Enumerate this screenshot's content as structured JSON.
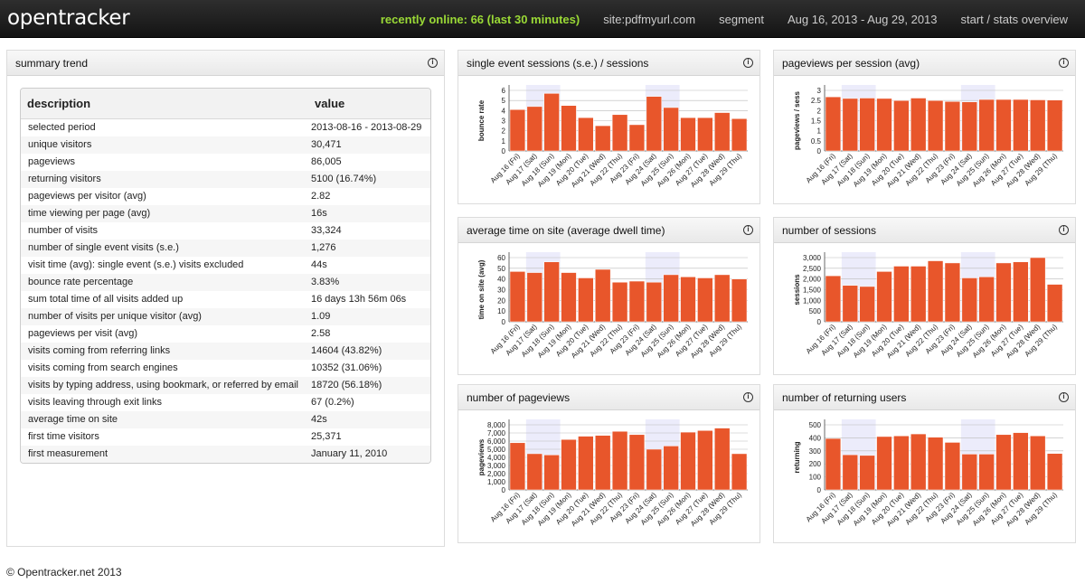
{
  "header": {
    "logo": "opentracker",
    "online": "recently online: 66 (last 30 minutes)",
    "site": "site:pdfmyurl.com",
    "segment": "segment",
    "period": "Aug 16, 2013 - Aug 29, 2013",
    "crumb": "start / stats overview"
  },
  "summary": {
    "title": "summary trend",
    "col_desc": "description",
    "col_value": "value",
    "rows": [
      {
        "d": "selected period",
        "v": "2013-08-16 - 2013-08-29"
      },
      {
        "d": "unique visitors",
        "v": "30,471"
      },
      {
        "d": "pageviews",
        "v": "86,005"
      },
      {
        "d": "returning visitors",
        "v": "5100 (16.74%)"
      },
      {
        "d": "pageviews per visitor (avg)",
        "v": "2.82"
      },
      {
        "d": "time viewing per page (avg)",
        "v": "16s"
      },
      {
        "d": "number of visits",
        "v": "33,324"
      },
      {
        "d": "number of single event visits (s.e.)",
        "v": "1,276"
      },
      {
        "d": "visit time (avg): single event (s.e.) visits excluded",
        "v": "44s"
      },
      {
        "d": "bounce rate percentage",
        "v": "3.83%"
      },
      {
        "d": "sum total time of all visits added up",
        "v": "16 days 13h 56m 06s"
      },
      {
        "d": "number of visits per unique visitor (avg)",
        "v": "1.09"
      },
      {
        "d": "pageviews per visit (avg)",
        "v": "2.58"
      },
      {
        "d": "visits coming from referring links",
        "v": "14604 (43.82%)"
      },
      {
        "d": "visits coming from search engines",
        "v": "10352 (31.06%)"
      },
      {
        "d": "visits by typing address, using bookmark, or referred by email",
        "v": "18720 (56.18%)"
      },
      {
        "d": "visits leaving through exit links",
        "v": "67 (0.2%)"
      },
      {
        "d": "average time on site",
        "v": "42s"
      },
      {
        "d": "first time visitors",
        "v": "25,371"
      },
      {
        "d": "first measurement",
        "v": "January 11, 2010"
      }
    ]
  },
  "colors": {
    "bar": "#e8562b",
    "weekend": "#ececfb",
    "grid": "#bbbbbb"
  },
  "chart_data": [
    {
      "type": "bar",
      "title": "single event sessions (s.e.) / sessions",
      "ylabel": "bounce rate",
      "ylim": [
        0,
        6
      ],
      "yticks": [
        "0",
        "1",
        "2",
        "3",
        "4",
        "5",
        "6"
      ],
      "categories": [
        "Aug 16 (Fri)",
        "Aug 17 (Sat)",
        "Aug 18 (Sun)",
        "Aug 19 (Mon)",
        "Aug 20 (Tue)",
        "Aug 21 (Wed)",
        "Aug 22 (Thu)",
        "Aug 23 (Fri)",
        "Aug 24 (Sat)",
        "Aug 25 (Sun)",
        "Aug 26 (Mon)",
        "Aug 27 (Tue)",
        "Aug 28 (Wed)",
        "Aug 29 (Thu)"
      ],
      "values": [
        4.1,
        4.4,
        5.7,
        4.5,
        3.3,
        2.5,
        3.6,
        2.6,
        5.4,
        4.3,
        3.3,
        3.3,
        3.8,
        3.2
      ]
    },
    {
      "type": "bar",
      "title": "pageviews per session (avg)",
      "ylabel": "pageviews / sess",
      "ylim": [
        0,
        3
      ],
      "yticks": [
        "0",
        "0.5",
        "1",
        "1.5",
        "2",
        "2.5",
        "3"
      ],
      "categories": [
        "Aug 16 (Fri)",
        "Aug 17 (Sat)",
        "Aug 18 (Sun)",
        "Aug 19 (Mon)",
        "Aug 20 (Tue)",
        "Aug 21 (Wed)",
        "Aug 22 (Thu)",
        "Aug 23 (Fri)",
        "Aug 24 (Sat)",
        "Aug 25 (Sun)",
        "Aug 26 (Mon)",
        "Aug 27 (Tue)",
        "Aug 28 (Wed)",
        "Aug 29 (Thu)"
      ],
      "values": [
        2.68,
        2.6,
        2.62,
        2.6,
        2.5,
        2.62,
        2.5,
        2.45,
        2.43,
        2.55,
        2.55,
        2.55,
        2.53,
        2.52
      ]
    },
    {
      "type": "bar",
      "title": "average time on site (average dwell time)",
      "ylabel": "time on site (avg)",
      "ylim": [
        0,
        60
      ],
      "yticks": [
        "0",
        "10",
        "20",
        "30",
        "40",
        "50",
        "60"
      ],
      "categories": [
        "Aug 16 (Fri)",
        "Aug 17 (Sat)",
        "Aug 18 (Sun)",
        "Aug 19 (Mon)",
        "Aug 20 (Tue)",
        "Aug 21 (Wed)",
        "Aug 22 (Thu)",
        "Aug 23 (Fri)",
        "Aug 24 (Sat)",
        "Aug 25 (Sun)",
        "Aug 26 (Mon)",
        "Aug 27 (Tue)",
        "Aug 28 (Wed)",
        "Aug 29 (Thu)"
      ],
      "values": [
        47,
        46,
        56,
        46,
        41,
        49,
        37,
        38,
        37,
        44,
        42,
        41,
        44,
        40
      ]
    },
    {
      "type": "bar",
      "title": "number of sessions",
      "ylabel": "sessions",
      "ylim": [
        0,
        3000
      ],
      "yticks": [
        "0",
        "500",
        "1,000",
        "1,500",
        "2,000",
        "2,500",
        "3,000"
      ],
      "categories": [
        "Aug 16 (Fri)",
        "Aug 17 (Sat)",
        "Aug 18 (Sun)",
        "Aug 19 (Mon)",
        "Aug 20 (Tue)",
        "Aug 21 (Wed)",
        "Aug 22 (Thu)",
        "Aug 23 (Fri)",
        "Aug 24 (Sat)",
        "Aug 25 (Sun)",
        "Aug 26 (Mon)",
        "Aug 27 (Tue)",
        "Aug 28 (Wed)",
        "Aug 29 (Thu)"
      ],
      "values": [
        2150,
        1700,
        1650,
        2350,
        2600,
        2600,
        2850,
        2750,
        2050,
        2100,
        2750,
        2800,
        3000,
        1750
      ]
    },
    {
      "type": "bar",
      "title": "number of pageviews",
      "ylabel": "pageviews",
      "ylim": [
        0,
        8000
      ],
      "yticks": [
        "0",
        "1,000",
        "2,000",
        "3,000",
        "4,000",
        "5,000",
        "6,000",
        "7,000",
        "8,000"
      ],
      "categories": [
        "Aug 16 (Fri)",
        "Aug 17 (Sat)",
        "Aug 18 (Sun)",
        "Aug 19 (Mon)",
        "Aug 20 (Tue)",
        "Aug 21 (Wed)",
        "Aug 22 (Thu)",
        "Aug 23 (Fri)",
        "Aug 24 (Sat)",
        "Aug 25 (Sun)",
        "Aug 26 (Mon)",
        "Aug 27 (Tue)",
        "Aug 28 (Wed)",
        "Aug 29 (Thu)"
      ],
      "values": [
        5800,
        4450,
        4300,
        6200,
        6600,
        6700,
        7200,
        6800,
        5000,
        5400,
        7100,
        7300,
        7600,
        4450
      ]
    },
    {
      "type": "bar",
      "title": "number of returning users",
      "ylabel": "returning",
      "ylim": [
        0,
        500
      ],
      "yticks": [
        "0",
        "100",
        "200",
        "300",
        "400",
        "500"
      ],
      "categories": [
        "Aug 16 (Fri)",
        "Aug 17 (Sat)",
        "Aug 18 (Sun)",
        "Aug 19 (Mon)",
        "Aug 20 (Tue)",
        "Aug 21 (Wed)",
        "Aug 22 (Thu)",
        "Aug 23 (Fri)",
        "Aug 24 (Sat)",
        "Aug 25 (Sun)",
        "Aug 26 (Mon)",
        "Aug 27 (Tue)",
        "Aug 28 (Wed)",
        "Aug 29 (Thu)"
      ],
      "values": [
        395,
        270,
        265,
        410,
        415,
        430,
        405,
        365,
        275,
        275,
        425,
        440,
        415,
        280
      ]
    }
  ],
  "footer": "© Opentracker.net 2013"
}
